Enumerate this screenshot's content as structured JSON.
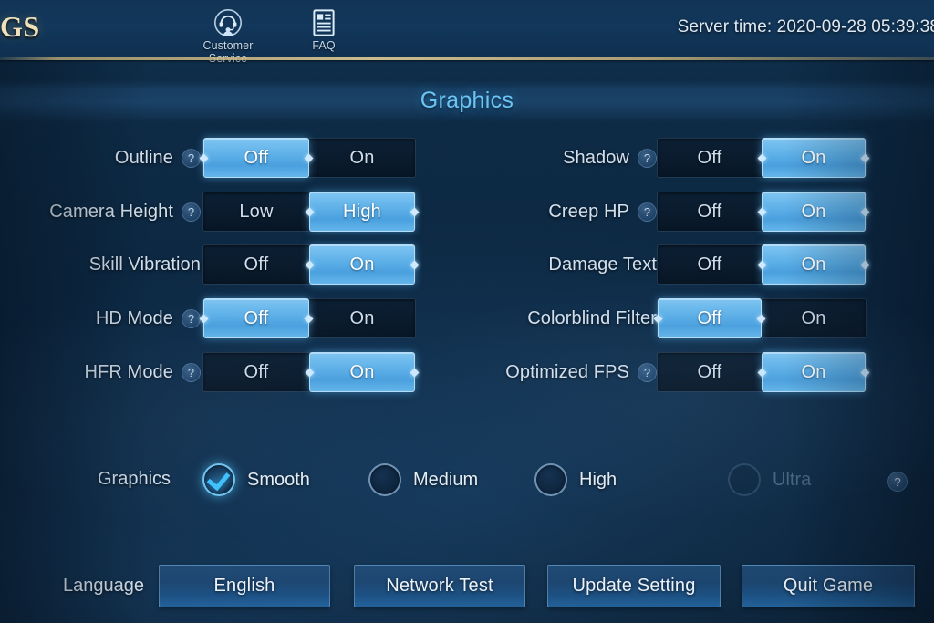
{
  "header": {
    "window_title": "GS",
    "actions": [
      {
        "label": "Customer Service",
        "icon": "customer-service-icon"
      },
      {
        "label": "FAQ",
        "icon": "faq-document-icon"
      }
    ],
    "server_time": "Server time: 2020-09-28 05:39:38"
  },
  "section": {
    "title": "Graphics",
    "title_color": "#6cc4f5"
  },
  "help_glyph": "?",
  "settings": {
    "left_column": [
      {
        "label": "Outline",
        "has_help": true,
        "options": [
          "Off",
          "On"
        ],
        "selected": 0
      },
      {
        "label": "Camera Height",
        "has_help": true,
        "options": [
          "Low",
          "High"
        ],
        "selected": 1
      },
      {
        "label": "Skill Vibration",
        "has_help": false,
        "options": [
          "Off",
          "On"
        ],
        "selected": 1
      },
      {
        "label": "HD Mode",
        "has_help": true,
        "options": [
          "Off",
          "On"
        ],
        "selected": 0
      },
      {
        "label": "HFR Mode",
        "has_help": true,
        "options": [
          "Off",
          "On"
        ],
        "selected": 1
      }
    ],
    "right_column": [
      {
        "label": "Shadow",
        "has_help": true,
        "options": [
          "Off",
          "On"
        ],
        "selected": 1
      },
      {
        "label": "Creep HP",
        "has_help": true,
        "options": [
          "Off",
          "On"
        ],
        "selected": 1
      },
      {
        "label": "Damage Text",
        "has_help": false,
        "options": [
          "Off",
          "On"
        ],
        "selected": 1
      },
      {
        "label": "Colorblind Filter",
        "has_help": false,
        "options": [
          "Off",
          "On"
        ],
        "selected": 0
      },
      {
        "label": "Optimized FPS",
        "has_help": true,
        "options": [
          "Off",
          "On"
        ],
        "selected": 1
      }
    ]
  },
  "quality": {
    "label": "Graphics",
    "options": [
      {
        "label": "Smooth",
        "checked": true,
        "disabled": false
      },
      {
        "label": "Medium",
        "checked": false,
        "disabled": false
      },
      {
        "label": "High",
        "checked": false,
        "disabled": false
      },
      {
        "label": "Ultra",
        "checked": false,
        "disabled": true
      }
    ],
    "help_glyph": "?"
  },
  "bottom": {
    "language_label": "Language",
    "buttons": [
      {
        "label": "English"
      },
      {
        "label": "Network Test"
      },
      {
        "label": "Update Setting"
      },
      {
        "label": "Quit Game"
      }
    ]
  },
  "colors": {
    "accent_blue": "#5db0e8",
    "title_gold": "#efe2bb",
    "panel_dark": "#0a1b2d",
    "text_primary": "#d2e0ee"
  }
}
